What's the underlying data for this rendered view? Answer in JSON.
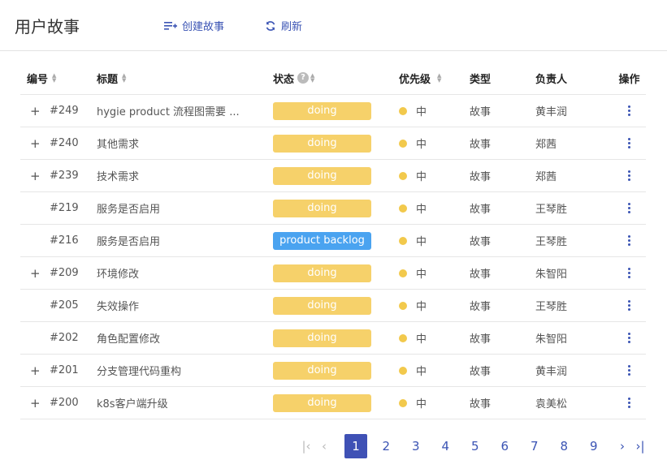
{
  "header": {
    "title": "用户故事",
    "create_label": "创建故事",
    "refresh_label": "刷新"
  },
  "columns": {
    "id": "编号",
    "title": "标题",
    "status": "状态",
    "priority": "优先级",
    "type": "类型",
    "owner": "负责人",
    "actions": "操作"
  },
  "rows": [
    {
      "expandable": true,
      "id": "#249",
      "title": "hygie product 流程图需要 ...",
      "status": "doing",
      "priority": "中",
      "type": "故事",
      "owner": "黄丰润"
    },
    {
      "expandable": true,
      "id": "#240",
      "title": "其他需求",
      "status": "doing",
      "priority": "中",
      "type": "故事",
      "owner": "郑茜"
    },
    {
      "expandable": true,
      "id": "#239",
      "title": "技术需求",
      "status": "doing",
      "priority": "中",
      "type": "故事",
      "owner": "郑茜"
    },
    {
      "expandable": false,
      "id": "#219",
      "title": "服务是否启用",
      "status": "doing",
      "priority": "中",
      "type": "故事",
      "owner": "王琴胜"
    },
    {
      "expandable": false,
      "id": "#216",
      "title": "服务是否启用",
      "status": "product backlog",
      "priority": "中",
      "type": "故事",
      "owner": "王琴胜"
    },
    {
      "expandable": true,
      "id": "#209",
      "title": "环境修改",
      "status": "doing",
      "priority": "中",
      "type": "故事",
      "owner": "朱智阳"
    },
    {
      "expandable": false,
      "id": "#205",
      "title": "失效操作",
      "status": "doing",
      "priority": "中",
      "type": "故事",
      "owner": "王琴胜"
    },
    {
      "expandable": false,
      "id": "#202",
      "title": "角色配置修改",
      "status": "doing",
      "priority": "中",
      "type": "故事",
      "owner": "朱智阳"
    },
    {
      "expandable": true,
      "id": "#201",
      "title": "分支管理代码重构",
      "status": "doing",
      "priority": "中",
      "type": "故事",
      "owner": "黄丰润"
    },
    {
      "expandable": true,
      "id": "#200",
      "title": "k8s客户端升级",
      "status": "doing",
      "priority": "中",
      "type": "故事",
      "owner": "袁美松"
    }
  ],
  "pagination": {
    "pages": [
      "1",
      "2",
      "3",
      "4",
      "5",
      "6",
      "7",
      "8",
      "9"
    ],
    "current": "1"
  },
  "colors": {
    "accent": "#3f51b5",
    "doing": "#f6d16a",
    "backlog": "#4aa3f0",
    "priority_medium": "#f2c94c"
  }
}
